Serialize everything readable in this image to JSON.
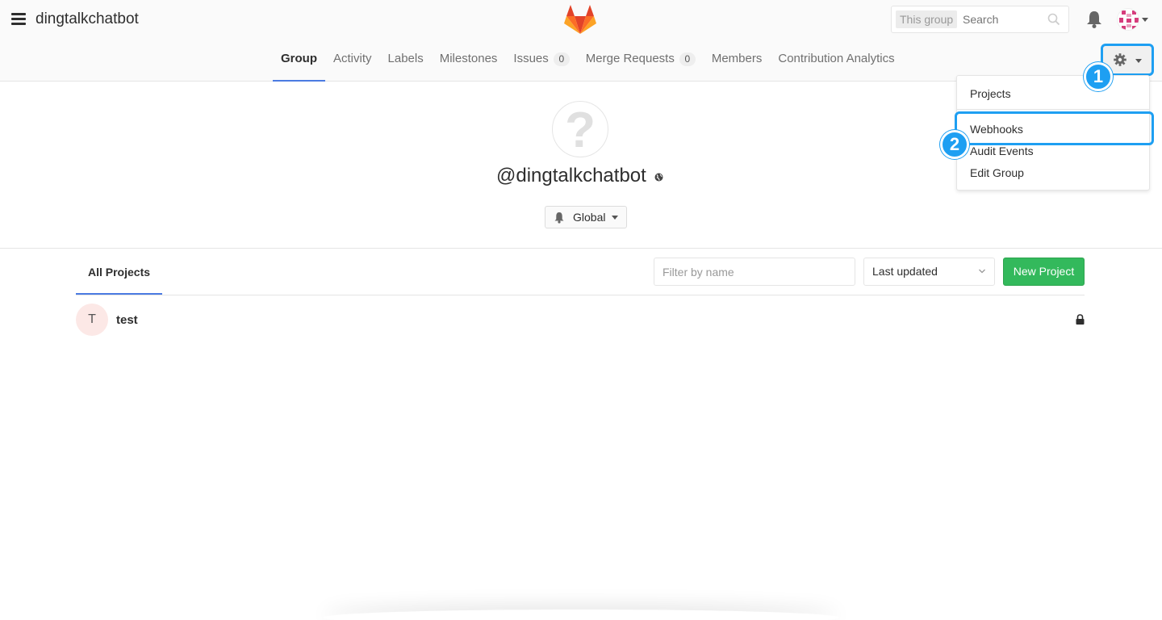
{
  "header": {
    "group_name": "dingtalkchatbot",
    "search_scope": "This group",
    "search_placeholder": "Search"
  },
  "nav": {
    "tabs": [
      {
        "label": "Group",
        "active": true
      },
      {
        "label": "Activity"
      },
      {
        "label": "Labels"
      },
      {
        "label": "Milestones"
      },
      {
        "label": "Issues",
        "badge": "0"
      },
      {
        "label": "Merge Requests",
        "badge": "0"
      },
      {
        "label": "Members"
      },
      {
        "label": "Contribution Analytics"
      }
    ]
  },
  "callouts": {
    "first": "1",
    "second": "2"
  },
  "settings_menu": {
    "items": [
      "Projects",
      "Webhooks",
      "Audit Events",
      "Edit Group"
    ]
  },
  "profile": {
    "avatar_glyph": "?",
    "handle": "@dingtalkchatbot",
    "notification_level": "Global"
  },
  "projects": {
    "tab_label": "All Projects",
    "filter_placeholder": "Filter by name",
    "sort_value": "Last updated",
    "new_button": "New Project",
    "list": [
      {
        "initial": "T",
        "name": "test",
        "visibility": "private"
      }
    ]
  },
  "colors": {
    "accent": "#1e9ff2",
    "active_tab": "#4b7be2",
    "new_project": "#33b95c"
  }
}
